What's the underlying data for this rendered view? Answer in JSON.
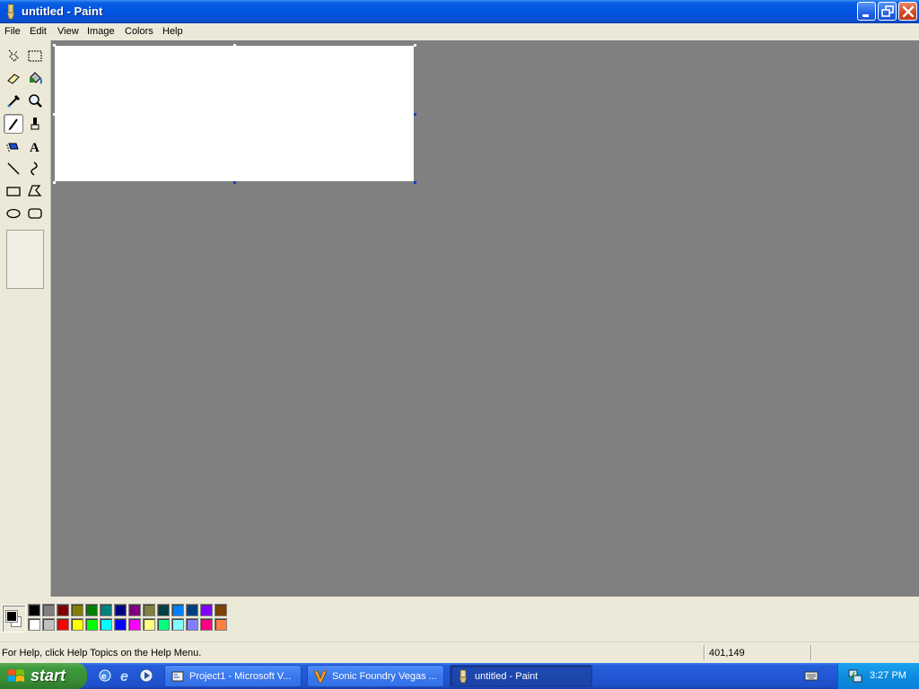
{
  "window": {
    "title": "untitled - Paint",
    "app_icon": "paint-brush-icon"
  },
  "menu": {
    "items": [
      "File",
      "Edit",
      "View",
      "Image",
      "Colors",
      "Help"
    ]
  },
  "toolbox": {
    "tools": [
      {
        "name": "free-form-select-icon"
      },
      {
        "name": "select-icon"
      },
      {
        "name": "eraser-icon"
      },
      {
        "name": "fill-with-color-icon"
      },
      {
        "name": "pick-color-icon"
      },
      {
        "name": "magnifier-icon"
      },
      {
        "name": "pencil-icon",
        "active": true
      },
      {
        "name": "brush-icon"
      },
      {
        "name": "airbrush-icon"
      },
      {
        "name": "text-icon",
        "glyph": "A"
      },
      {
        "name": "line-icon"
      },
      {
        "name": "curve-icon"
      },
      {
        "name": "rectangle-icon"
      },
      {
        "name": "polygon-icon"
      },
      {
        "name": "ellipse-icon"
      },
      {
        "name": "rounded-rectangle-icon"
      }
    ]
  },
  "palette": {
    "foreground": "#000000",
    "background": "#ffffff",
    "top_row": [
      "#000000",
      "#808080",
      "#800000",
      "#808000",
      "#008000",
      "#008080",
      "#000080",
      "#800080",
      "#808040",
      "#004040",
      "#0080ff",
      "#004080",
      "#8000ff",
      "#804000"
    ],
    "bottom_row": [
      "#ffffff",
      "#c0c0c0",
      "#ff0000",
      "#ffff00",
      "#00ff00",
      "#00ffff",
      "#0000ff",
      "#ff00ff",
      "#ffff80",
      "#00ff80",
      "#80ffff",
      "#8080ff",
      "#ff0080",
      "#ff8040"
    ]
  },
  "status": {
    "help_text": "For Help, click Help Topics on the Help Menu.",
    "coordinates": "401,149"
  },
  "taskbar": {
    "start_label": "start",
    "quick_launch": [
      "ie-icon",
      "ie-blue-icon",
      "media-player-icon"
    ],
    "buttons": [
      {
        "label": "Project1 - Microsoft V...",
        "icon": "vb-project-icon",
        "active": false
      },
      {
        "label": "Sonic Foundry Vegas ...",
        "icon": "vegas-icon",
        "active": false
      },
      {
        "label": "untitled - Paint",
        "icon": "paint-brush-icon",
        "active": true
      }
    ],
    "clock": "3:27 PM"
  }
}
